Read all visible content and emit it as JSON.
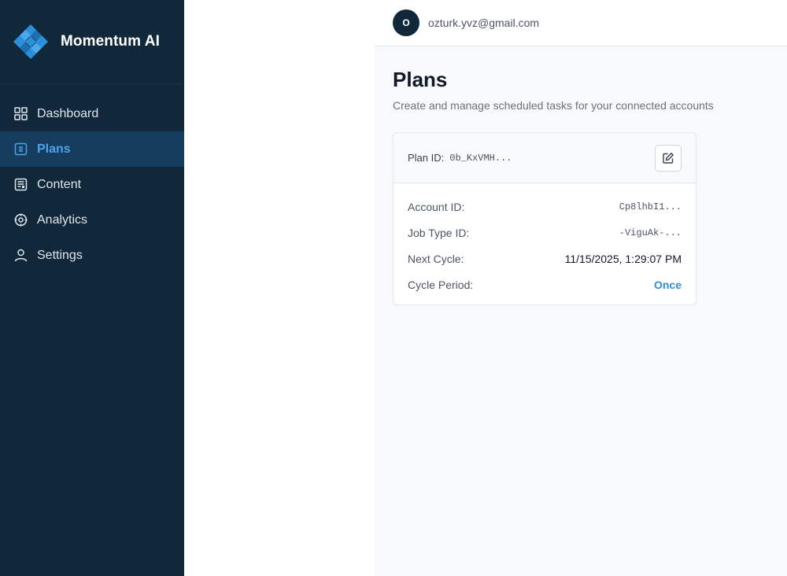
{
  "app": {
    "name": "Momentum AI"
  },
  "sidebar": {
    "items": [
      {
        "label": "Dashboard",
        "icon": "grid-icon",
        "active": false
      },
      {
        "label": "Plans",
        "icon": "list-icon",
        "active": true
      },
      {
        "label": "Content",
        "icon": "document-icon",
        "active": false
      },
      {
        "label": "Analytics",
        "icon": "target-icon",
        "active": false
      },
      {
        "label": "Settings",
        "icon": "user-icon",
        "active": false
      }
    ]
  },
  "header": {
    "avatar_initial": "O",
    "email": "ozturk.yvz@gmail.com"
  },
  "page": {
    "title": "Plans",
    "subtitle": "Create and manage scheduled tasks for your connected accounts"
  },
  "plan_card": {
    "plan_id_label": "Plan ID:",
    "plan_id_value": "0b_KxVMH...",
    "fields": [
      {
        "label": "Account ID:",
        "value": "Cp8lhbI1..."
      },
      {
        "label": "Job Type ID:",
        "value": "-ViguAk-..."
      },
      {
        "label": "Next Cycle:",
        "value": "11/15/2025, 1:29:07 PM"
      },
      {
        "label": "Cycle Period:",
        "value": "Once"
      }
    ]
  },
  "colors": {
    "sidebar_bg": "#11273a",
    "active_bg": "#163d5e",
    "accent": "#4ba3ea",
    "link": "#2f8fdc"
  }
}
